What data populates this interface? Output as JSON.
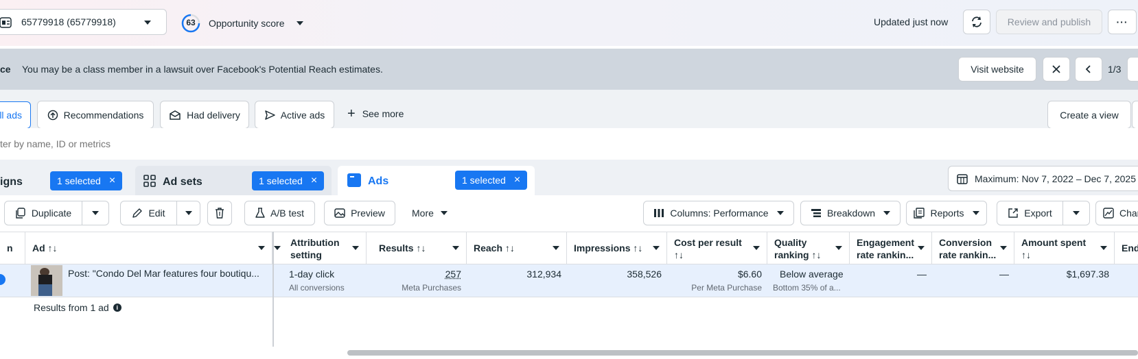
{
  "topbar": {
    "account_label": "65779918 (65779918)",
    "opportunity_score": "63",
    "opportunity_label": "Opportunity score",
    "updated_text": "Updated just now",
    "review_publish": "Review and publish",
    "more_dots": "···"
  },
  "notice": {
    "prefix": "ce",
    "message": "You may be a class member in a lawsuit over Facebook's Potential Reach estimates.",
    "visit_website": "Visit website",
    "pager": "1/3"
  },
  "filters": {
    "all_ads": "ll ads",
    "recommendations": "Recommendations",
    "had_delivery": "Had delivery",
    "active_ads": "Active ads",
    "see_more": "See more",
    "create_view": "Create a view"
  },
  "search": {
    "placeholder": "ter by name, ID or metrics"
  },
  "levels": {
    "campaigns": "igns",
    "campaigns_badge": "1 selected",
    "adsets": "Ad sets",
    "adsets_badge": "1 selected",
    "ads": "Ads",
    "ads_badge": "1 selected",
    "date_range": "Maximum: Nov 7, 2022 – Dec 7, 2025"
  },
  "toolbar": {
    "duplicate": "Duplicate",
    "edit": "Edit",
    "ab_test": "A/B test",
    "preview": "Preview",
    "more": "More",
    "columns": "Columns: Performance",
    "breakdown": "Breakdown",
    "reports": "Reports",
    "export": "Export",
    "charts": "Char"
  },
  "table": {
    "headers": {
      "col0": "n",
      "ad": "Ad ↑↓",
      "attribution_l1": "Attribution",
      "attribution_l2": "setting",
      "results": "Results ↑↓",
      "reach": "Reach ↑↓",
      "impressions": "Impressions ↑↓",
      "cpr_l1": "Cost per result",
      "cpr_l2": "↑↓",
      "quality_l1": "Quality",
      "quality_l2": "ranking ↑↓",
      "engagement_l1": "Engagement",
      "engagement_l2": "rate rankin...",
      "conversion_l1": "Conversion",
      "conversion_l2": "rate rankin...",
      "spent_l1": "Amount spent",
      "spent_l2": "↑↓",
      "end": "End"
    },
    "row": {
      "ad_name": "Post: \"Condo Del Mar features four boutiqu...",
      "attribution": "1-day click",
      "attribution_sub": "All conversions",
      "results": "257",
      "results_sub": "Meta Purchases",
      "reach": "312,934",
      "impressions": "358,526",
      "cpr": "$6.60",
      "cpr_sub": "Per Meta Purchase",
      "quality": "Below average",
      "quality_sub": "Bottom 35% of a...",
      "engagement": "—",
      "conversion": "—",
      "spent": "$1,697.38"
    },
    "footer": "Results from 1 ad"
  },
  "colors": {
    "accent": "#1877f2",
    "notice_bg": "#cfd6de",
    "row_selected": "#e7f0fd"
  }
}
